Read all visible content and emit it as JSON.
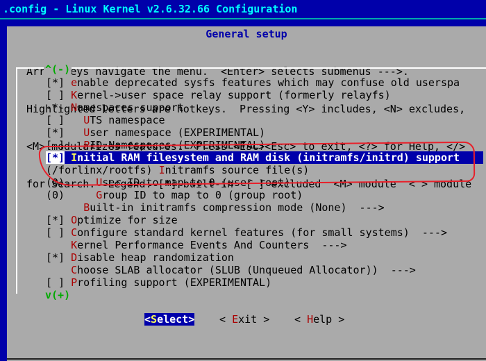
{
  "window": {
    "title": ".config - Linux Kernel v2.6.32.66 Configuration"
  },
  "dialog": {
    "title": "General setup",
    "help_lines": [
      "Arrow keys navigate the menu.  <Enter> selects submenus --->.",
      "Highlighted letters are hotkeys.  Pressing <Y> includes, <N> excludes,",
      "<M> modularizes features.  Press <Esc><Esc> to exit, <?> for Help, </>",
      "for Search.  Legend: [*] built-in  [ ] excluded  <M> module  < > module"
    ],
    "scroll_up": "^(-)",
    "scroll_down": "v(+)"
  },
  "menu": [
    {
      "mark": "[*]",
      "pre": " ",
      "hot": "e",
      "rest": "nable deprecated sysfs features which may confuse old userspa"
    },
    {
      "mark": "[ ]",
      "pre": " ",
      "hot": "K",
      "rest": "ernel->user space relay support (formerly relayfs)"
    },
    {
      "mark": "-*-",
      "pre": " ",
      "hot": "N",
      "rest": "amespaces support"
    },
    {
      "mark": "[ ]",
      "pre": "   ",
      "hot": "U",
      "rest": "TS namespace"
    },
    {
      "mark": "[*]",
      "pre": "   ",
      "hot": "U",
      "rest": "ser namespace (EXPERIMENTAL)"
    },
    {
      "mark": "[ ]",
      "pre": "   ",
      "hot": "P",
      "rest": "ID Namespaces (EXPERIMENTAL)"
    },
    {
      "mark": "[*]",
      "pre": " ",
      "hot": "I",
      "rest": "nitial RAM filesystem and RAM disk (initramfs/initrd) support"
    },
    {
      "mark": "(/forlinx/rootfs)",
      "pre": " ",
      "hot": "I",
      "rest": "nitramfs source file(s)"
    },
    {
      "mark": "(0)",
      "pre": "     ",
      "hot": "U",
      "rest": "ser ID to map to 0 (user root)"
    },
    {
      "mark": "(0)",
      "pre": "     ",
      "hot": "G",
      "rest": "roup ID to map to 0 (group root)"
    },
    {
      "mark": "   ",
      "pre": "   ",
      "hot": "B",
      "rest": "uilt-in initramfs compression mode (None)  --->"
    },
    {
      "mark": "[*]",
      "pre": " ",
      "hot": "O",
      "rest": "ptimize for size"
    },
    {
      "mark": "[ ]",
      "pre": " ",
      "hot": "C",
      "rest": "onfigure standard kernel features (for small systems)  --->"
    },
    {
      "mark": "   ",
      "pre": " ",
      "hot": "K",
      "rest": "ernel Performance Events And Counters  --->"
    },
    {
      "mark": "[*]",
      "pre": " ",
      "hot": "D",
      "rest": "isable heap randomization"
    },
    {
      "mark": "   ",
      "pre": " ",
      "hot": "C",
      "rest": "hoose SLAB allocator (SLUB (Unqueued Allocator))  --->"
    },
    {
      "mark": "[ ]",
      "pre": " ",
      "hot": "P",
      "rest": "rofiling support (EXPERIMENTAL)"
    }
  ],
  "selected_index": 6,
  "buttons": [
    {
      "open": "<",
      "hot": "S",
      "rest": "elect",
      "close": ">"
    },
    {
      "open": "< ",
      "hot": "E",
      "rest": "xit",
      "close": " >"
    },
    {
      "open": "< ",
      "hot": "H",
      "rest": "elp",
      "close": " >"
    }
  ],
  "colors": {
    "background": "#0000aa",
    "dialog": "#aaaaaa",
    "title": "#00ffff",
    "hotkey": "#aa0000",
    "selected_hotkey": "#ffff55",
    "annotation": "#e8202a"
  }
}
